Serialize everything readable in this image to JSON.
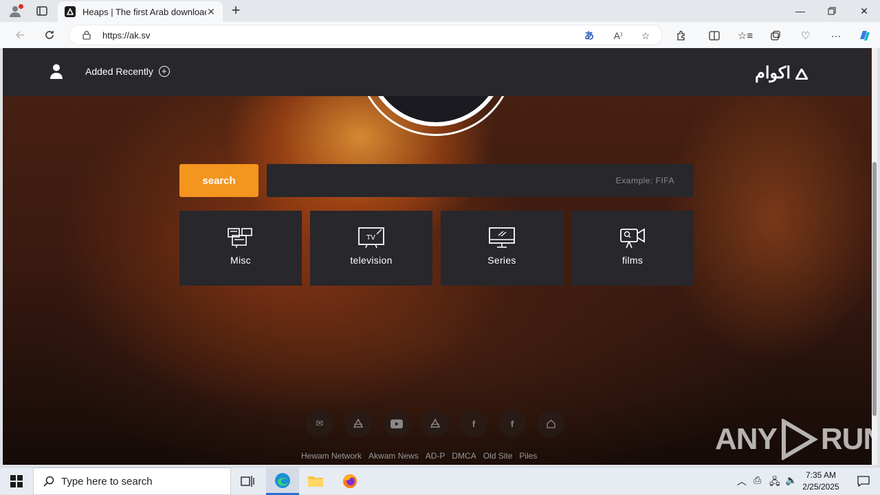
{
  "browser": {
    "tab_title": "Heaps | The first Arab download",
    "url": "https://ak.sv"
  },
  "site": {
    "header": {
      "added_recently": "Added Recently",
      "logo_text": "اكوام"
    },
    "search": {
      "button_label": "search",
      "placeholder": "Example: FIFA"
    },
    "categories": [
      {
        "label": "Misc",
        "icon": "misc-icon"
      },
      {
        "label": "television",
        "icon": "tv-icon"
      },
      {
        "label": "Series",
        "icon": "monitor-icon"
      },
      {
        "label": "films",
        "icon": "camera-icon"
      }
    ],
    "socials": [
      "mail-icon",
      "akwam-icon",
      "youtube-icon",
      "akwam-icon",
      "facebook-icon",
      "facebook-icon",
      "home-icon"
    ],
    "footer_links": [
      "Hewam Network",
      "Akwam News",
      "AD-P",
      "DMCA",
      "Old Site",
      "Piles"
    ]
  },
  "watermark": {
    "left": "ANY",
    "right": "RUN"
  },
  "taskbar": {
    "search_placeholder": "Type here to search",
    "time": "7:35 AM",
    "date": "2/25/2025"
  }
}
